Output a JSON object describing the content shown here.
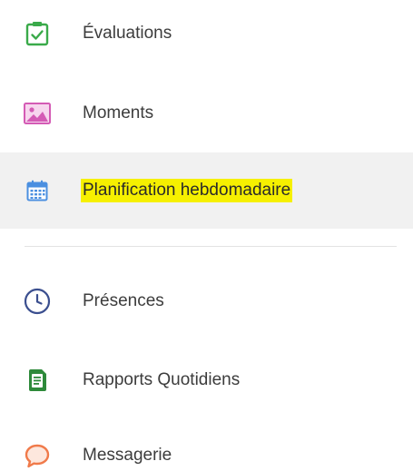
{
  "menu": {
    "items": [
      {
        "label": "Évaluations",
        "icon": "clipboard-check-icon",
        "color": "#3aaa4a"
      },
      {
        "label": "Moments",
        "icon": "image-icon",
        "color": "#d45bb5"
      },
      {
        "label": "Planification hebdomadaire",
        "icon": "calendar-icon",
        "color": "#4a8fe0",
        "active": true,
        "highlight_color": "#f6f000"
      },
      {
        "label": "Présences",
        "icon": "clock-icon",
        "color": "#3b4f8f"
      },
      {
        "label": "Rapports Quotidiens",
        "icon": "daily-report-icon",
        "color": "#2e8a3a"
      },
      {
        "label": "Messagerie",
        "icon": "chat-bubble-icon",
        "color": "#f07a4a"
      }
    ]
  }
}
